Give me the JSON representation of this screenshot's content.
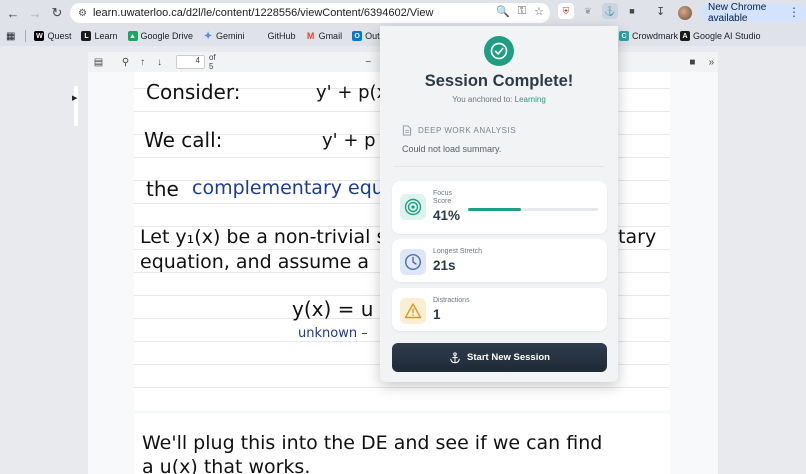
{
  "browser": {
    "url": "learn.uwaterloo.ca/d2l/le/content/1228556/viewContent/6394602/View",
    "update_label": "New Chrome available",
    "bookmarks": [
      {
        "label": "Quest",
        "icon": "quest-icon",
        "color": "#000000"
      },
      {
        "label": "Learn",
        "icon": "learn-icon",
        "color": "#1a1a1a"
      },
      {
        "label": "Google Drive",
        "icon": "drive-icon",
        "color": "#1fa463"
      },
      {
        "label": "Gemini",
        "icon": "gemini-icon",
        "color": "#4c8df6"
      },
      {
        "label": "GitHub",
        "icon": "github-icon",
        "color": "#24292e"
      },
      {
        "label": "Gmail",
        "icon": "gmail-icon",
        "color": "#ea4335"
      },
      {
        "label": "Outlook",
        "icon": "outlook-icon",
        "color": "#0078d4"
      }
    ],
    "bookmarks_right": [
      {
        "label": "Crowdmark",
        "icon": "crowdmark-icon",
        "color": "#2aa5a5"
      },
      {
        "label": "Google AI Studio",
        "icon": "ai-studio-icon",
        "color": "#1a1a1a"
      }
    ]
  },
  "pdf": {
    "page_number": "4",
    "page_total": "of 5"
  },
  "notes": {
    "line1_label": "Consider:",
    "line1_eq": "y' + p(x",
    "line2_label": "We call:",
    "line2_eq": "y' + p",
    "line3_prefix": "the",
    "line3_blue": "complementary equ",
    "line4_a": "Let y₁(x) be a non-trivial s",
    "line4_b": "ntary",
    "line5": "equation, and assume a",
    "line6_eq": "y(x) = u",
    "line7_blue": "unknown –",
    "page2_line1": "We'll plug this into the DE and see if we can find",
    "page2_line2": "a u(x) that works."
  },
  "popup": {
    "title": "Session Complete!",
    "subtitle_prefix": "You anchored to:",
    "subtitle_accent": "Learning",
    "analysis_heading": "DEEP WORK ANALYSIS",
    "analysis_body": "Could not load summary.",
    "stats": {
      "focus_label_1": "Focus",
      "focus_label_2": "Score",
      "focus_value": "41%",
      "focus_fraction": 0.41,
      "stretch_label": "Longest Stretch",
      "stretch_value": "21s",
      "distractions_label": "Distractions",
      "distractions_value": "1"
    },
    "button_label": "Start New Session",
    "colors": {
      "accent": "#1f9e83",
      "dark": "#2b3a4a",
      "focus_icon_bg": "#dff3ee",
      "stretch_icon_bg": "#dde7f7",
      "distraction_icon_bg": "#fbeed2"
    }
  }
}
